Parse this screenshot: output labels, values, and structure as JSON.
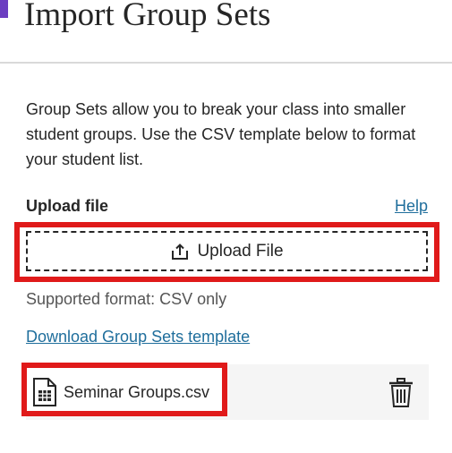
{
  "page": {
    "title": "Import Group Sets"
  },
  "content": {
    "description": "Group Sets allow you to break your class into smaller student groups. Use the CSV template below to format your student list.",
    "upload_label": "Upload file",
    "help_link": "Help",
    "upload_button_label": "Upload File",
    "supported_format": "Supported format: CSV only",
    "template_link": "Download Group Sets template"
  },
  "file": {
    "name": "Seminar Groups.csv",
    "icon": "csv-file-icon",
    "delete_icon": "trash-icon"
  },
  "colors": {
    "accent": "#6c3ec1",
    "link": "#1f6e9c",
    "highlight": "#e01a1a"
  }
}
